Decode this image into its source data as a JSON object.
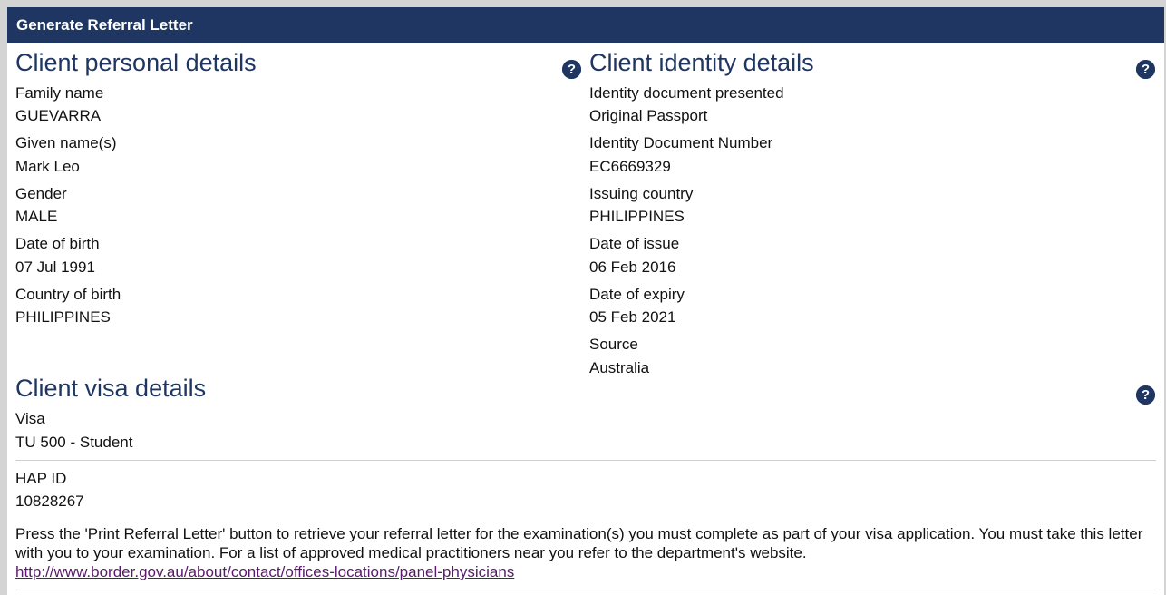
{
  "header": {
    "title": "Generate Referral Letter"
  },
  "personal": {
    "title": "Client personal details",
    "help_glyph": "?",
    "fields": [
      {
        "label": "Family name",
        "value": "GUEVARRA"
      },
      {
        "label": "Given name(s)",
        "value": "Mark Leo"
      },
      {
        "label": "Gender",
        "value": "MALE"
      },
      {
        "label": "Date of birth",
        "value": "07 Jul 1991"
      },
      {
        "label": "Country of birth",
        "value": "PHILIPPINES"
      }
    ]
  },
  "identity": {
    "title": "Client identity details",
    "help_glyph": "?",
    "fields": [
      {
        "label": "Identity document presented",
        "value": "Original Passport"
      },
      {
        "label": "Identity Document Number",
        "value": "EC6669329"
      },
      {
        "label": "Issuing country",
        "value": "PHILIPPINES"
      },
      {
        "label": "Date of issue",
        "value": "06 Feb 2016"
      },
      {
        "label": "Date of expiry",
        "value": "05 Feb 2021"
      },
      {
        "label": "Source",
        "value": "Australia"
      }
    ]
  },
  "visa": {
    "title": "Client visa details",
    "help_glyph": "?",
    "label": "Visa",
    "value": "TU 500 - Student"
  },
  "hap": {
    "label": "HAP ID",
    "value": "10828267"
  },
  "instructions": {
    "text": "Press the 'Print Referral Letter' button to retrieve your referral letter for the examination(s) you must complete as part of your visa application. You must take this letter with you to your examination. For a list of approved medical practitioners near you refer to the department's website.",
    "link": "http://www.border.gov.au/about/contact/offices-locations/panel-physicians"
  },
  "colors": {
    "header_bg": "#1e3661",
    "title_color": "#1e3661",
    "link_color": "#5a1a6b"
  },
  "icons": {
    "help": "help-icon"
  }
}
